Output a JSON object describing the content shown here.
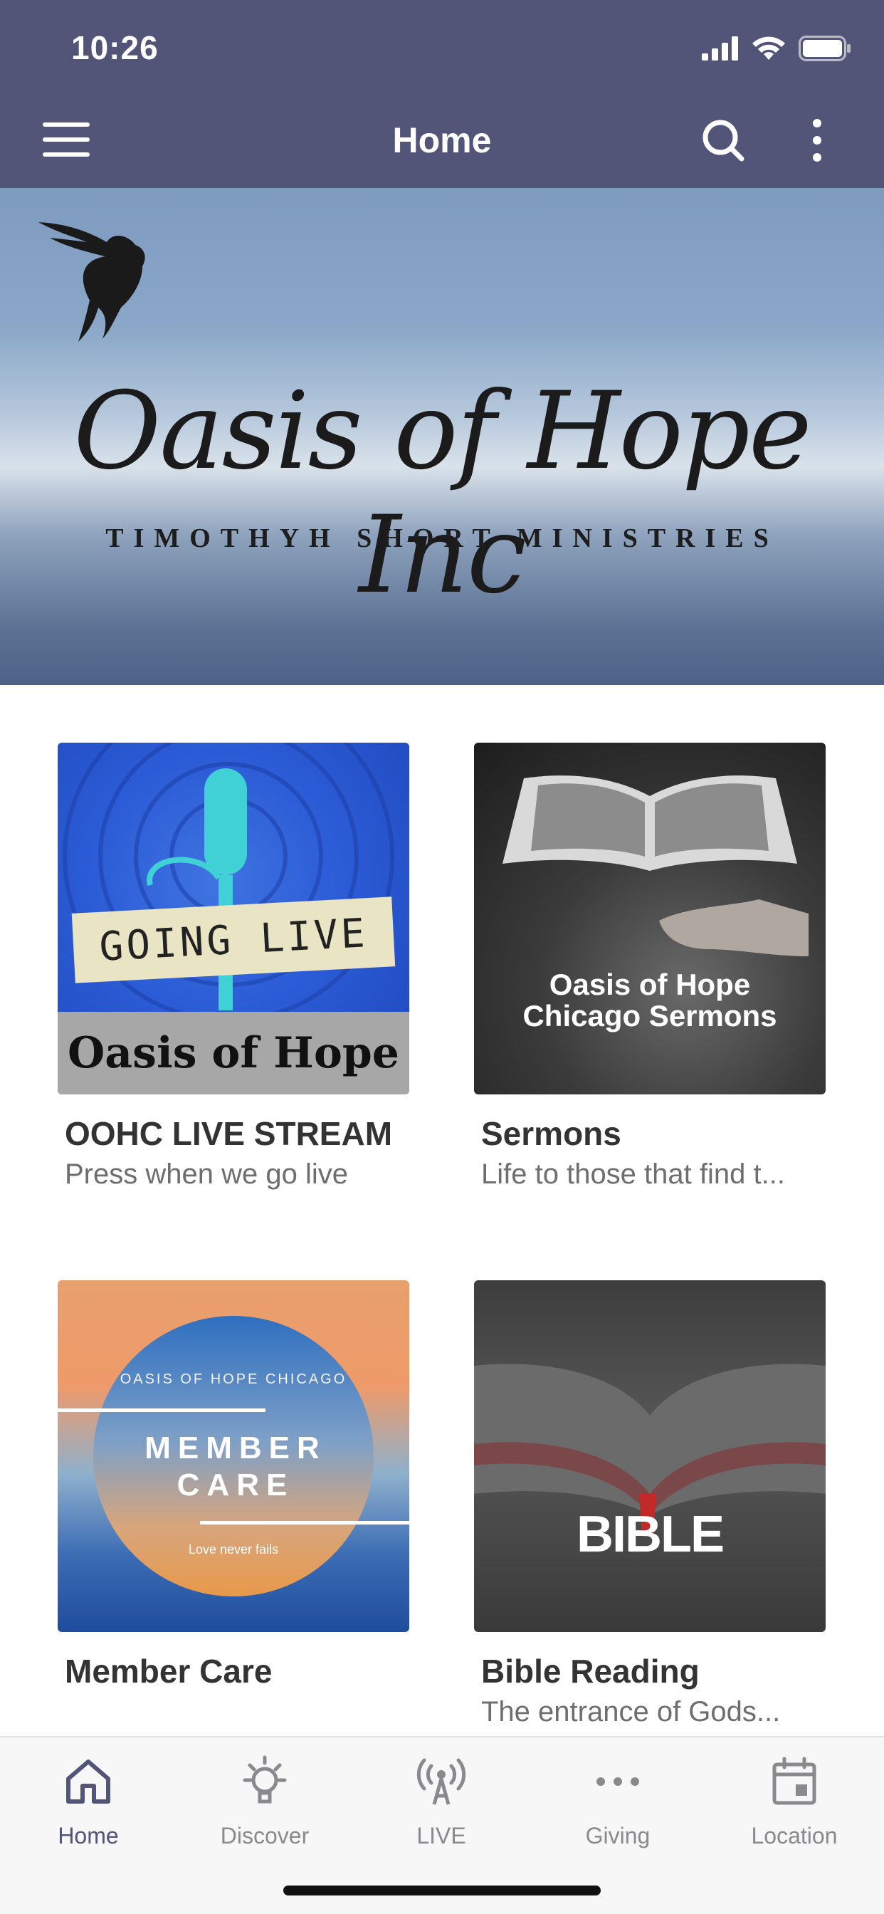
{
  "status_bar": {
    "time": "10:26"
  },
  "nav": {
    "title": "Home",
    "menu_icon": "hamburger-menu-icon",
    "search_icon": "search-icon",
    "more_icon": "more-vertical-icon"
  },
  "hero": {
    "title": "Oasis of Hope Inc",
    "subtitle": "TIMOTHYH SHORT MINISTRIES"
  },
  "cards": [
    {
      "image_heading": "GOING LIVE",
      "image_caption": "Oasis of Hope",
      "title": "OOHC LIVE STREAM",
      "subtitle": "Press when we go live"
    },
    {
      "image_caption": "Oasis of Hope Chicago Sermons",
      "title": "Sermons",
      "subtitle": "Life to those that find t..."
    },
    {
      "image_top": "OASIS OF HOPE CHICAGO",
      "image_heading": "MEMBER CARE",
      "image_caption": "Love never fails",
      "title": "Member Care",
      "subtitle": ""
    },
    {
      "image_caption": "BIBLE",
      "title": "Bible Reading",
      "subtitle": "The entrance of Gods..."
    }
  ],
  "tabs": [
    {
      "label": "Home",
      "icon": "home-icon",
      "active": true
    },
    {
      "label": "Discover",
      "icon": "lightbulb-icon",
      "active": false
    },
    {
      "label": "LIVE",
      "icon": "broadcast-icon",
      "active": false
    },
    {
      "label": "Giving",
      "icon": "ellipsis-icon",
      "active": false
    },
    {
      "label": "Location",
      "icon": "calendar-icon",
      "active": false
    }
  ],
  "colors": {
    "header": "#525577",
    "active_tab": "#525577",
    "inactive_tab": "#8a8a8e"
  }
}
